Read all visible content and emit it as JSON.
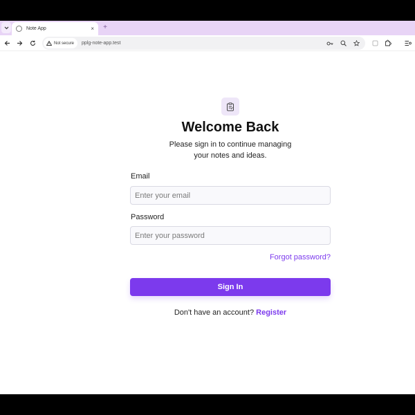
{
  "browser": {
    "tab_title": "Note App",
    "tab_close": "×",
    "new_tab": "+",
    "security_label": "Not secure",
    "url": "pplg-note-app.test",
    "colors": {
      "tabstrip": "#e8d4f6",
      "omnibox": "#f1f1f3"
    },
    "icons": [
      "back-arrow-icon",
      "forward-arrow-icon",
      "reload-icon",
      "warning-icon",
      "password-key-icon",
      "zoom-icon",
      "bookmark-star-icon",
      "extension-icon",
      "extensions-puzzle-icon",
      "profile-menu-icon"
    ]
  },
  "login": {
    "logo_icon": "note-clipboard-icon",
    "title": "Welcome Back",
    "subtitle": "Please sign in to continue managing your notes and ideas.",
    "email_label": "Email",
    "email_placeholder": "Enter your email",
    "email_value": "",
    "password_label": "Password",
    "password_placeholder": "Enter your password",
    "password_value": "",
    "forgot_password": "Forgot password?",
    "sign_in": "Sign In",
    "no_account": "Don't have an account?",
    "register": "Register",
    "colors": {
      "accent": "#7c3aed",
      "logo_bg": "#eee6f8"
    }
  }
}
